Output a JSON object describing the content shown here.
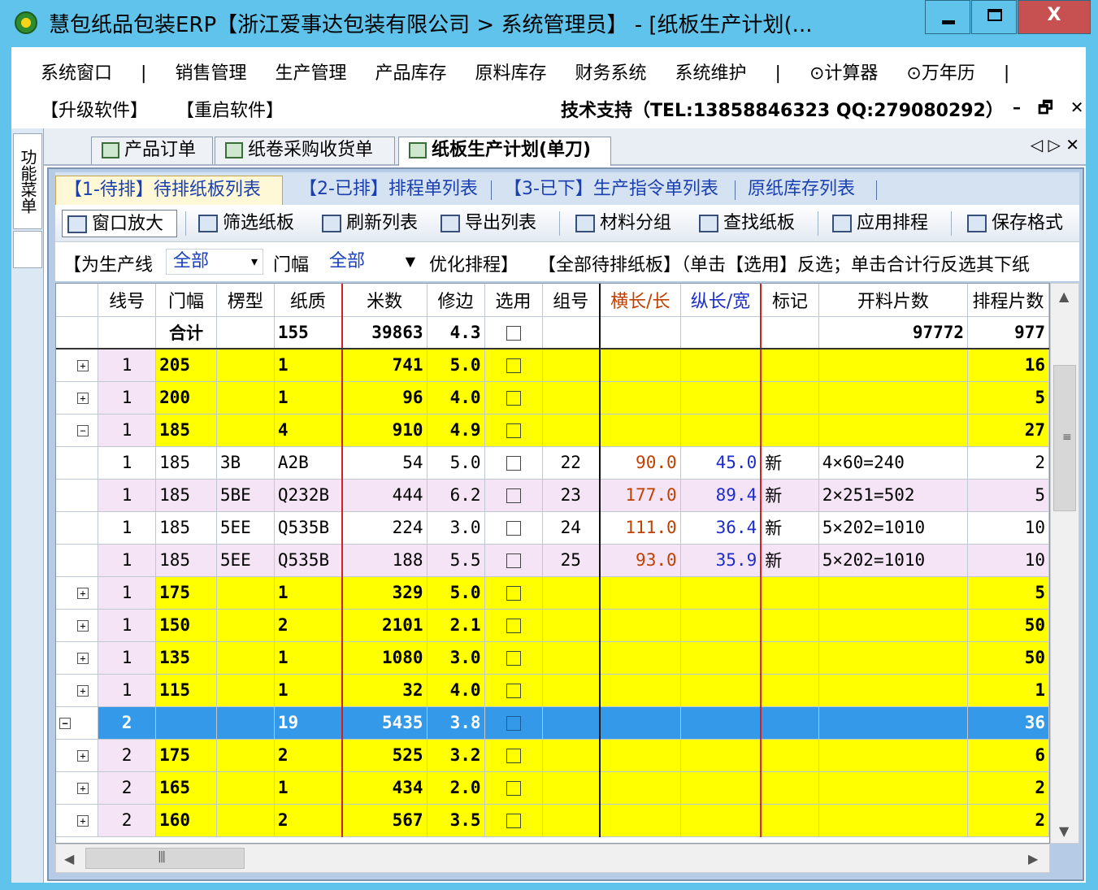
{
  "window": {
    "title": "慧包纸品包装ERP【浙江爱事达包装有限公司 > 系统管理员】 - [纸板生产计划(...",
    "close_label": "X"
  },
  "menu": {
    "row1": [
      "系统窗口",
      "|",
      "销售管理",
      "生产管理",
      "产品库存",
      "原料库存",
      "财务系统",
      "系统维护",
      "|",
      "⊙计算器",
      "⊙万年历",
      "|"
    ],
    "row2": [
      "【升级软件】",
      "【重启软件】"
    ],
    "support": "技术支持（TEL:13858846323  QQ:279080292）",
    "mdi_buttons": [
      "–",
      "🗗",
      "✕"
    ]
  },
  "side_panel": {
    "tab_label": "功能菜单"
  },
  "doc_tabs": [
    {
      "label": "产品订单",
      "active": false
    },
    {
      "label": "纸卷采购收货单",
      "active": false
    },
    {
      "label": "纸板生产计划(单刀)",
      "active": true
    }
  ],
  "doc_nav": "◁ ▷ ✕",
  "sub_tabs": [
    {
      "label": "【1-待排】待排纸板列表",
      "active": true
    },
    {
      "label": "【2-已排】排程单列表",
      "active": false
    },
    {
      "label": "【3-已下】生产指令单列表",
      "active": false
    },
    {
      "label": "原纸库存列表",
      "active": false
    }
  ],
  "toolbar": [
    {
      "label": "窗口放大",
      "icon": "window-icon"
    },
    {
      "label": "筛选纸板",
      "icon": "filter-icon"
    },
    {
      "label": "刷新列表",
      "icon": "refresh-icon"
    },
    {
      "label": "导出列表",
      "icon": "export-icon"
    },
    {
      "label": "材料分组",
      "icon": "group-icon"
    },
    {
      "label": "查找纸板",
      "icon": "binoculars-icon"
    },
    {
      "label": "应用排程",
      "icon": "check-icon"
    },
    {
      "label": "保存格式",
      "icon": "save-icon"
    }
  ],
  "filter": {
    "line_label": "【为生产线",
    "line_value": "全部",
    "width_label": "门幅",
    "width_value": "全部",
    "opt_label": "优化排程】",
    "hint": "【全部待排纸板】（单击【选用】反选；单击合计行反选其下纸"
  },
  "grid": {
    "columns": [
      "线号",
      "门幅",
      "楞型",
      "纸质",
      "米数",
      "修边",
      "选用",
      "组号",
      "横长/长",
      "纵长/宽",
      "标记",
      "开料片数",
      "排程片数"
    ],
    "summary": {
      "label": "合计",
      "paper": "155",
      "meters": "39863",
      "trim": "4.3",
      "pieces": "97772",
      "sched": "977"
    },
    "rows": [
      {
        "type": "group",
        "toggle": "+",
        "line": "1",
        "width": "205",
        "flute": "",
        "paper": "1",
        "meters": "741",
        "trim": "5.0",
        "group": "",
        "hlen": "",
        "vlen": "",
        "mark": "",
        "cut": "",
        "sched": "16"
      },
      {
        "type": "group",
        "toggle": "+",
        "line": "1",
        "width": "200",
        "flute": "",
        "paper": "1",
        "meters": "96",
        "trim": "4.0",
        "group": "",
        "hlen": "",
        "vlen": "",
        "mark": "",
        "cut": "",
        "sched": "5"
      },
      {
        "type": "group",
        "toggle": "−",
        "line": "1",
        "width": "185",
        "flute": "",
        "paper": "4",
        "meters": "910",
        "trim": "4.9",
        "group": "",
        "hlen": "",
        "vlen": "",
        "mark": "",
        "cut": "",
        "sched": "27"
      },
      {
        "type": "detail",
        "alt": false,
        "line": "1",
        "width": "185",
        "flute": "3B",
        "paper": "A2B",
        "meters": "54",
        "trim": "5.0",
        "group": "22",
        "hlen": "90.0",
        "vlen": "45.0",
        "mark": "新",
        "cut": "4×60=240",
        "sched": "2"
      },
      {
        "type": "detail",
        "alt": true,
        "line": "1",
        "width": "185",
        "flute": "5BE",
        "paper": "Q232B",
        "meters": "444",
        "trim": "6.2",
        "group": "23",
        "hlen": "177.0",
        "vlen": "89.4",
        "mark": "新",
        "cut": "2×251=502",
        "sched": "5"
      },
      {
        "type": "detail",
        "alt": false,
        "line": "1",
        "width": "185",
        "flute": "5EE",
        "paper": "Q535B",
        "meters": "224",
        "trim": "3.0",
        "group": "24",
        "hlen": "111.0",
        "vlen": "36.4",
        "mark": "新",
        "cut": "5×202=1010",
        "sched": "10"
      },
      {
        "type": "detail",
        "alt": true,
        "line": "1",
        "width": "185",
        "flute": "5EE",
        "paper": "Q535B",
        "meters": "188",
        "trim": "5.5",
        "group": "25",
        "hlen": "93.0",
        "vlen": "35.9",
        "mark": "新",
        "cut": "5×202=1010",
        "sched": "10"
      },
      {
        "type": "group",
        "toggle": "+",
        "line": "1",
        "width": "175",
        "flute": "",
        "paper": "1",
        "meters": "329",
        "trim": "5.0",
        "group": "",
        "hlen": "",
        "vlen": "",
        "mark": "",
        "cut": "",
        "sched": "5"
      },
      {
        "type": "group",
        "toggle": "+",
        "line": "1",
        "width": "150",
        "flute": "",
        "paper": "2",
        "meters": "2101",
        "trim": "2.1",
        "group": "",
        "hlen": "",
        "vlen": "",
        "mark": "",
        "cut": "",
        "sched": "50"
      },
      {
        "type": "group",
        "toggle": "+",
        "line": "1",
        "width": "135",
        "flute": "",
        "paper": "1",
        "meters": "1080",
        "trim": "3.0",
        "group": "",
        "hlen": "",
        "vlen": "",
        "mark": "",
        "cut": "",
        "sched": "50"
      },
      {
        "type": "group",
        "toggle": "+",
        "line": "1",
        "width": "115",
        "flute": "",
        "paper": "1",
        "meters": "32",
        "trim": "4.0",
        "group": "",
        "hlen": "",
        "vlen": "",
        "mark": "",
        "cut": "",
        "sched": "1"
      },
      {
        "type": "selected",
        "toggle": "−",
        "line": "2",
        "width": "",
        "flute": "",
        "paper": "19",
        "meters": "5435",
        "trim": "3.8",
        "group": "",
        "hlen": "",
        "vlen": "",
        "mark": "",
        "cut": "",
        "sched": "36"
      },
      {
        "type": "group",
        "toggle": "+",
        "line": "2",
        "width": "175",
        "flute": "",
        "paper": "2",
        "meters": "525",
        "trim": "3.2",
        "group": "",
        "hlen": "",
        "vlen": "",
        "mark": "",
        "cut": "",
        "sched": "6"
      },
      {
        "type": "group",
        "toggle": "+",
        "line": "2",
        "width": "165",
        "flute": "",
        "paper": "1",
        "meters": "434",
        "trim": "2.0",
        "group": "",
        "hlen": "",
        "vlen": "",
        "mark": "",
        "cut": "",
        "sched": "2"
      },
      {
        "type": "group",
        "toggle": "+",
        "line": "2",
        "width": "160",
        "flute": "",
        "paper": "2",
        "meters": "567",
        "trim": "3.5",
        "group": "",
        "hlen": "",
        "vlen": "",
        "mark": "",
        "cut": "",
        "sched": "2"
      }
    ]
  },
  "colors": {
    "group_row": "#ffff00",
    "selected_row": "#3399e8",
    "alt_row": "#f5e4f5",
    "hlen_text": "#c04000",
    "vlen_text": "#1c2cc8"
  }
}
